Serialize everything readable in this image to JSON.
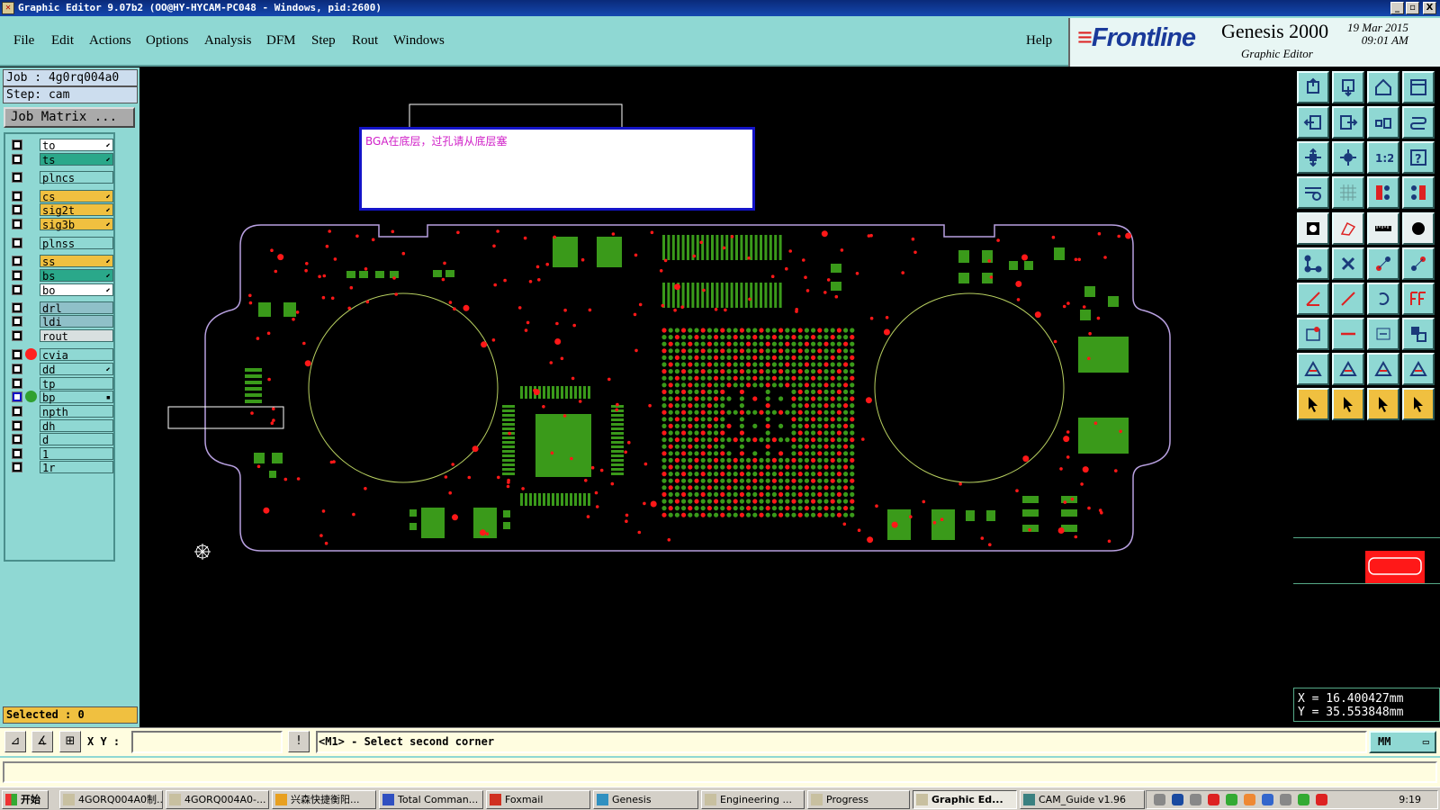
{
  "window": {
    "title": "Graphic Editor 9.07b2 (OO@HY-HYCAM-PC048 - Windows, pid:2600)",
    "controls": [
      "_",
      "▫",
      "X"
    ]
  },
  "menu": {
    "items": [
      "File",
      "Edit",
      "Actions",
      "Options",
      "Analysis",
      "DFM",
      "Step",
      "Rout",
      "Windows"
    ],
    "help": "Help"
  },
  "brand": {
    "logo": "Frontline",
    "product": "Genesis 2000",
    "subtitle": "Graphic Editor",
    "date": "19 Mar 2015",
    "time": "09:01 AM"
  },
  "job": {
    "job_label": "Job : 4g0rq004a0",
    "step_label": "Step: cam",
    "matrix_button": "Job Matrix ..."
  },
  "layers": [
    {
      "name": "to",
      "color": "#ffffff",
      "arrow": true
    },
    {
      "name": "ts",
      "color": "#2aa88a",
      "arrow": true
    },
    {
      "name": "plncs",
      "color": "#8fd8d3",
      "arrow": false
    },
    {
      "name": "cs",
      "color": "#f0c040",
      "arrow": true
    },
    {
      "name": "sig2t",
      "color": "#f0c040",
      "arrow": true
    },
    {
      "name": "sig3b",
      "color": "#f0c040",
      "arrow": true
    },
    {
      "name": "plnss",
      "color": "#8fd8d3",
      "arrow": false
    },
    {
      "name": "ss",
      "color": "#f0c040",
      "arrow": true
    },
    {
      "name": "bs",
      "color": "#2aa88a",
      "arrow": true
    },
    {
      "name": "bo",
      "color": "#ffffff",
      "arrow": true
    },
    {
      "name": "drl",
      "color": "#8fc0c8",
      "arrow": false
    },
    {
      "name": "ldi",
      "color": "#8fc0c8",
      "arrow": false
    },
    {
      "name": "rout",
      "color": "#d8e0e0",
      "arrow": false
    },
    {
      "name": "cvia",
      "color": "#8fd8d3",
      "arrow": false,
      "dot": "#ff2020"
    },
    {
      "name": "dd",
      "color": "#8fd8d3",
      "arrow": true
    },
    {
      "name": "tp",
      "color": "#8fd8d3",
      "arrow": false
    },
    {
      "name": "bp",
      "color": "#8fd8d3",
      "arrow": false,
      "dot": "#30a030",
      "square": true
    },
    {
      "name": "npth",
      "color": "#8fd8d3",
      "arrow": false
    },
    {
      "name": "dh",
      "color": "#8fd8d3",
      "arrow": false
    },
    {
      "name": "d",
      "color": "#8fd8d3",
      "arrow": false
    },
    {
      "name": "1",
      "color": "#8fd8d3",
      "arrow": false
    },
    {
      "name": "1r",
      "color": "#8fd8d3",
      "arrow": false
    }
  ],
  "selected": "Selected : 0",
  "note": {
    "text": "BGA在底层，过孔请从底层塞"
  },
  "board": {
    "pad_color": "#3a9a1a",
    "via_color": "#ff1818",
    "outline_color": "#b8a0e0",
    "circle_color": "#b8d060"
  },
  "toolbox": [
    {
      "icon": "open-step-icon",
      "style": "c"
    },
    {
      "icon": "save-icon",
      "style": "c"
    },
    {
      "icon": "home-icon",
      "style": "c"
    },
    {
      "icon": "window-icon",
      "style": "c"
    },
    {
      "icon": "zoom-left-icon",
      "style": "c"
    },
    {
      "icon": "zoom-right-icon",
      "style": "c"
    },
    {
      "icon": "swap-icon",
      "style": "c"
    },
    {
      "icon": "redraw-icon",
      "style": "c"
    },
    {
      "icon": "fit-icon",
      "style": "c"
    },
    {
      "icon": "center-icon",
      "style": "c"
    },
    {
      "icon": "ratio-icon",
      "style": "c"
    },
    {
      "icon": "help-icon",
      "style": "c"
    },
    {
      "icon": "measure-icon",
      "style": "c"
    },
    {
      "icon": "grid-icon",
      "style": "c"
    },
    {
      "icon": "net-icon",
      "style": "c"
    },
    {
      "icon": "net-2-icon",
      "style": "c"
    },
    {
      "icon": "pad-icon",
      "style": "w"
    },
    {
      "icon": "line-icon",
      "style": "w"
    },
    {
      "icon": "ruler-icon",
      "style": "w"
    },
    {
      "icon": "dot-icon",
      "style": "w"
    },
    {
      "icon": "connect-icon",
      "style": "c"
    },
    {
      "icon": "cross-icon",
      "style": "c"
    },
    {
      "icon": "node-icon",
      "style": "c"
    },
    {
      "icon": "node-2-icon",
      "style": "c"
    },
    {
      "icon": "angle-icon",
      "style": "c"
    },
    {
      "icon": "slash-icon",
      "style": "c"
    },
    {
      "icon": "arc-icon",
      "style": "c"
    },
    {
      "icon": "ff-icon",
      "style": "c"
    },
    {
      "icon": "move-icon",
      "style": "c"
    },
    {
      "icon": "minus-icon",
      "style": "c"
    },
    {
      "icon": "resize-icon",
      "style": "c"
    },
    {
      "icon": "copy-icon",
      "style": "c"
    },
    {
      "icon": "triangle-icon",
      "style": "c"
    },
    {
      "icon": "triangle-2-icon",
      "style": "c"
    },
    {
      "icon": "triangle-3-icon",
      "style": "c"
    },
    {
      "icon": "triangle-4-icon",
      "style": "c"
    },
    {
      "icon": "pointer-icon",
      "style": "y"
    },
    {
      "icon": "pointer-2-icon",
      "style": "y"
    },
    {
      "icon": "pointer-3-icon",
      "style": "y"
    },
    {
      "icon": "pointer-4-icon",
      "style": "y"
    }
  ],
  "coords": {
    "x": "X = 16.400427mm",
    "y": "Y = 35.553848mm"
  },
  "command": {
    "xy_label": "X Y :",
    "xy_value": "",
    "prompt": "<M1> - Select second corner",
    "units": "MM"
  },
  "taskbar": {
    "start": "开始",
    "tasks": [
      {
        "label": "4GORQ004A0制..."
      },
      {
        "label": "4GORQ004A0-..."
      },
      {
        "label": "兴森快捷衡阳..."
      },
      {
        "label": "Total Comman..."
      },
      {
        "label": "Foxmail"
      },
      {
        "label": "Genesis"
      },
      {
        "label": "Engineering ..."
      },
      {
        "label": "Progress"
      },
      {
        "label": "Graphic Ed...",
        "active": true
      },
      {
        "label": "CAM_Guide v1.96"
      }
    ],
    "clock": "9:19"
  }
}
